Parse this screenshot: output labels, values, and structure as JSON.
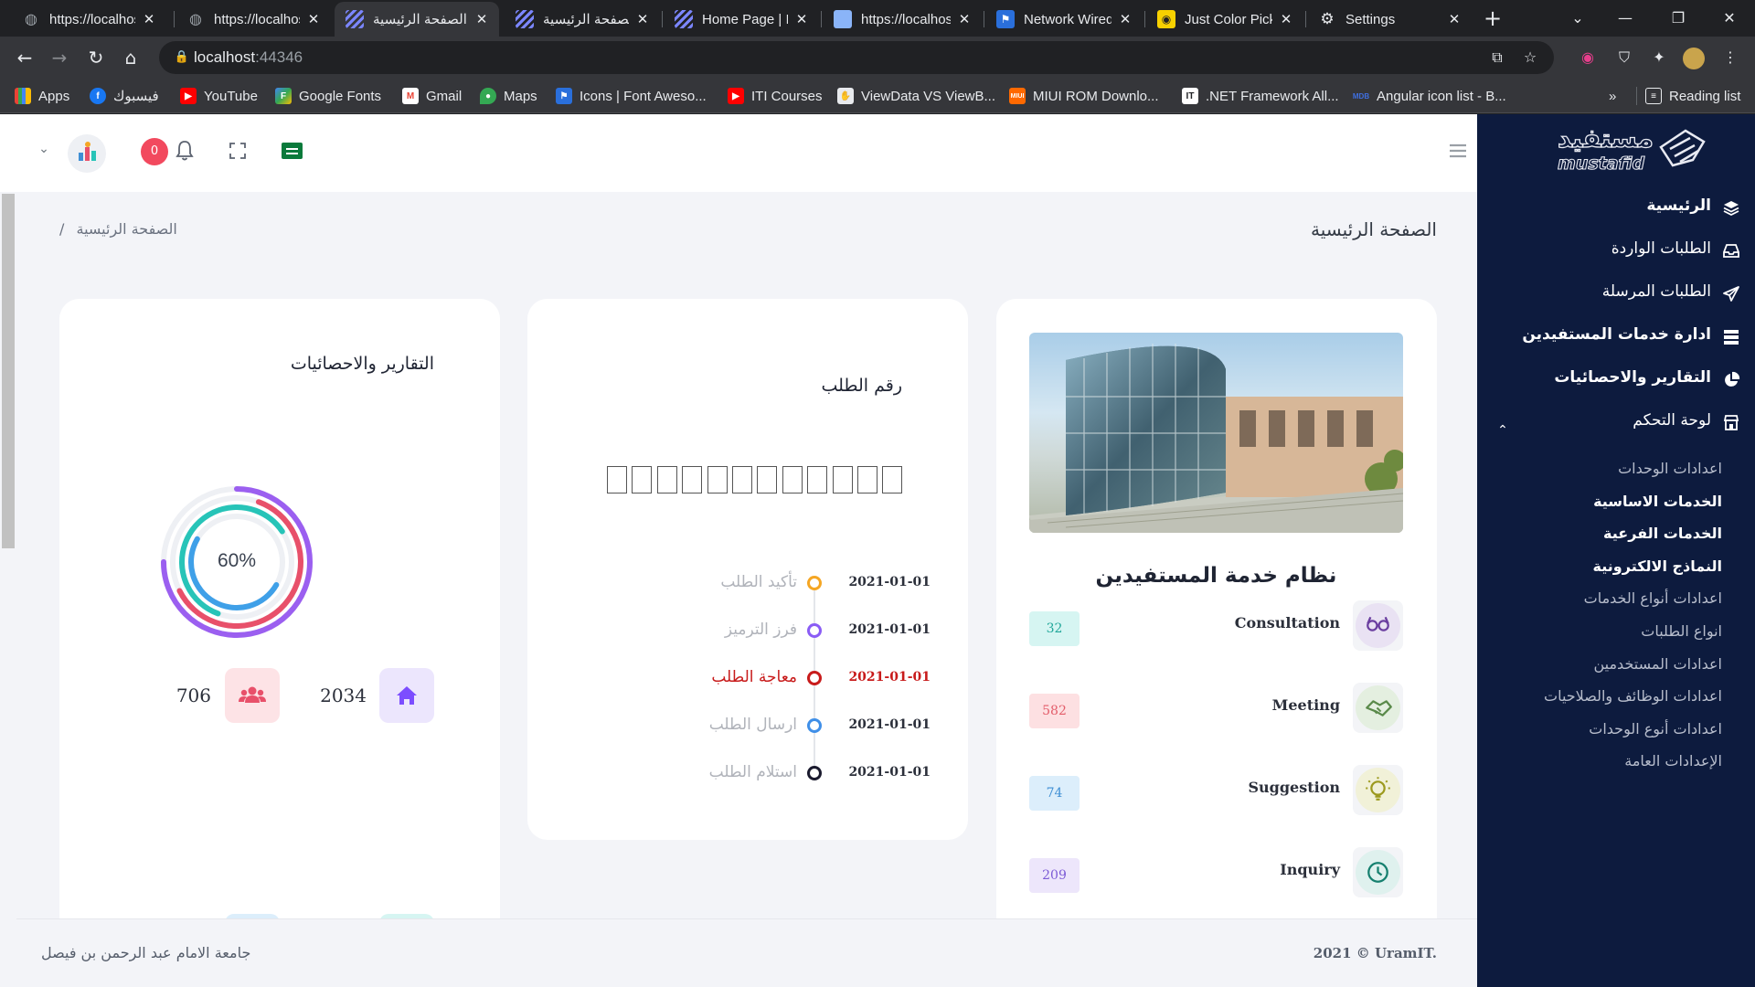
{
  "browser": {
    "tabs": [
      {
        "label": "https://localhost",
        "favicon": "globe-icon"
      },
      {
        "label": "https://localhost",
        "favicon": "globe-icon"
      },
      {
        "label": "الصفحة الرئيسية",
        "favicon": "stripes-icon"
      },
      {
        "label": "الصفحة الرئيسية",
        "favicon": "stripes-icon"
      },
      {
        "label": "Home Page | IA",
        "favicon": "stripes-icon"
      },
      {
        "label": "https://localhost",
        "favicon": "document-icon"
      },
      {
        "label": "Network Wired",
        "favicon": "flag-icon"
      },
      {
        "label": "Just Color Picker",
        "favicon": "eyedropper-icon"
      },
      {
        "label": "Settings",
        "favicon": "gear-icon"
      }
    ],
    "url_host": "localhost",
    "url_port": ":44346",
    "bookmarks": [
      {
        "label": "Apps",
        "icon": "apps-grid-icon"
      },
      {
        "label": "فيسبوك",
        "icon": "facebook-icon"
      },
      {
        "label": "YouTube",
        "icon": "youtube-icon"
      },
      {
        "label": "Google Fonts",
        "icon": "google-fonts-icon"
      },
      {
        "label": "Gmail",
        "icon": "gmail-icon"
      },
      {
        "label": "Maps",
        "icon": "maps-icon"
      },
      {
        "label": "Icons | Font Aweso...",
        "icon": "flag-icon"
      },
      {
        "label": "ITI Courses",
        "icon": "youtube-icon"
      },
      {
        "label": "ViewData VS ViewB...",
        "icon": "hand-icon"
      },
      {
        "label": "MIUI ROM Downlo...",
        "icon": "miui-icon"
      },
      {
        "label": ".NET Framework All...",
        "icon": "it-icon"
      },
      {
        "label": "Angular icon list - B...",
        "icon": "mdb-icon"
      }
    ],
    "bookmarks_more": "»",
    "reading_list": "Reading list"
  },
  "header": {
    "notification_count": "0",
    "language_flag": "saudi-flag-icon"
  },
  "page": {
    "title": "الصفحة الرئيسية",
    "breadcrumb": "الصفحة الرئيسية",
    "breadcrumb_sep": "/"
  },
  "sidebar": {
    "logo_text": "mustafid",
    "logo_arabic": "مستفيد",
    "items": [
      {
        "label": "الرئيسية",
        "icon": "layers-icon",
        "bold": true
      },
      {
        "label": "الطلبات الواردة",
        "icon": "inbox-icon",
        "bold": false
      },
      {
        "label": "الطلبات المرسلة",
        "icon": "paper-plane-icon",
        "bold": false
      },
      {
        "label": "ادارة خدمات المستفيدين",
        "icon": "server-icon",
        "bold": true
      },
      {
        "label": "التقارير والاحصائيات",
        "icon": "pie-chart-icon",
        "bold": true
      },
      {
        "label": "لوحة التحكم",
        "icon": "store-icon",
        "bold": false
      }
    ],
    "subitems": [
      {
        "label": "اعدادات الوحدات",
        "bold": false
      },
      {
        "label": "الخدمات الاساسية",
        "bold": true
      },
      {
        "label": "الخدمات الفرعية",
        "bold": true
      },
      {
        "label": "النماذج الالكترونية",
        "bold": true
      },
      {
        "label": "اعدادات أنواع الخدمات",
        "bold": false
      },
      {
        "label": "انواع الطلبات",
        "bold": false
      },
      {
        "label": "اعدادات المستخدمين",
        "bold": false
      },
      {
        "label": "اعدادات الوظائف والصلاحيات",
        "bold": false
      },
      {
        "label": "اعدادات أنوع الوحدات",
        "bold": false
      },
      {
        "label": "الإعدادات العامة",
        "bold": false
      }
    ]
  },
  "services_card": {
    "title": "نظام خدمة المستفيدين",
    "image": "university-building-photo",
    "rows": [
      {
        "label": "Consultation",
        "count": "32",
        "icon": "glasses-icon",
        "icon_bg": "#e9e2f3",
        "icon_color": "#6b3fa0",
        "badge_bg": "#d6f5f2",
        "badge_color": "#22a79a"
      },
      {
        "label": "Meeting",
        "count": "582",
        "icon": "handshake-icon",
        "icon_bg": "#e4efe0",
        "icon_color": "#5a8a4a",
        "badge_bg": "#fde0e2",
        "badge_color": "#e35d6a"
      },
      {
        "label": "Suggestion",
        "count": "74",
        "icon": "lightbulb-icon",
        "icon_bg": "#f1f1d8",
        "icon_color": "#9c9a1e",
        "badge_bg": "#dceefb",
        "badge_color": "#3f8fd4"
      },
      {
        "label": "Inquiry",
        "count": "209",
        "icon": "clock-icon",
        "icon_bg": "#dff1ee",
        "icon_color": "#16806f",
        "badge_bg": "#ede6fb",
        "badge_color": "#7c5bd6"
      }
    ]
  },
  "request_card": {
    "title": "رقم الطلب",
    "digit_boxes": 12,
    "timeline": [
      {
        "label": "تأكيد الطلب",
        "date": "2021-01-01",
        "dot_color": "#f5a623",
        "text_color": "#b0b3ba"
      },
      {
        "label": "فرز الترميز",
        "date": "2021-01-01",
        "dot_color": "#8a5cf5",
        "text_color": "#b0b3ba"
      },
      {
        "label": "معاجة الطلب",
        "date": "2021-01-01",
        "dot_color": "#c81b1b",
        "text_color": "#c81b1b"
      },
      {
        "label": "ارسال الطلب",
        "date": "2021-01-01",
        "dot_color": "#3f8fe8",
        "text_color": "#b0b3ba"
      },
      {
        "label": "استلام الطلب",
        "date": "2021-01-01",
        "dot_color": "#1a1a2e",
        "text_color": "#b0b3ba"
      }
    ]
  },
  "reports_card": {
    "title": "التقارير والاحصائيات",
    "percent_label": "60%",
    "rings": [
      {
        "color": "#9b5ff0",
        "fraction": 0.75
      },
      {
        "color": "#e8506a",
        "fraction": 0.62
      },
      {
        "color": "#27c4b8",
        "fraction": 0.6
      },
      {
        "color": "#3fa0e8",
        "fraction": 0.5
      }
    ],
    "stats": [
      {
        "value": "2034",
        "icon": "home-icon",
        "icon_bg": "#ece6fd",
        "icon_color": "#7c4dff"
      },
      {
        "value": "706",
        "icon": "users-icon",
        "icon_bg": "#fde3e6",
        "icon_color": "#e8506a"
      }
    ]
  },
  "footer": {
    "org": "جامعة الامام عبد الرحمن بن فيصل",
    "copyright": "2021 © UramIT."
  }
}
